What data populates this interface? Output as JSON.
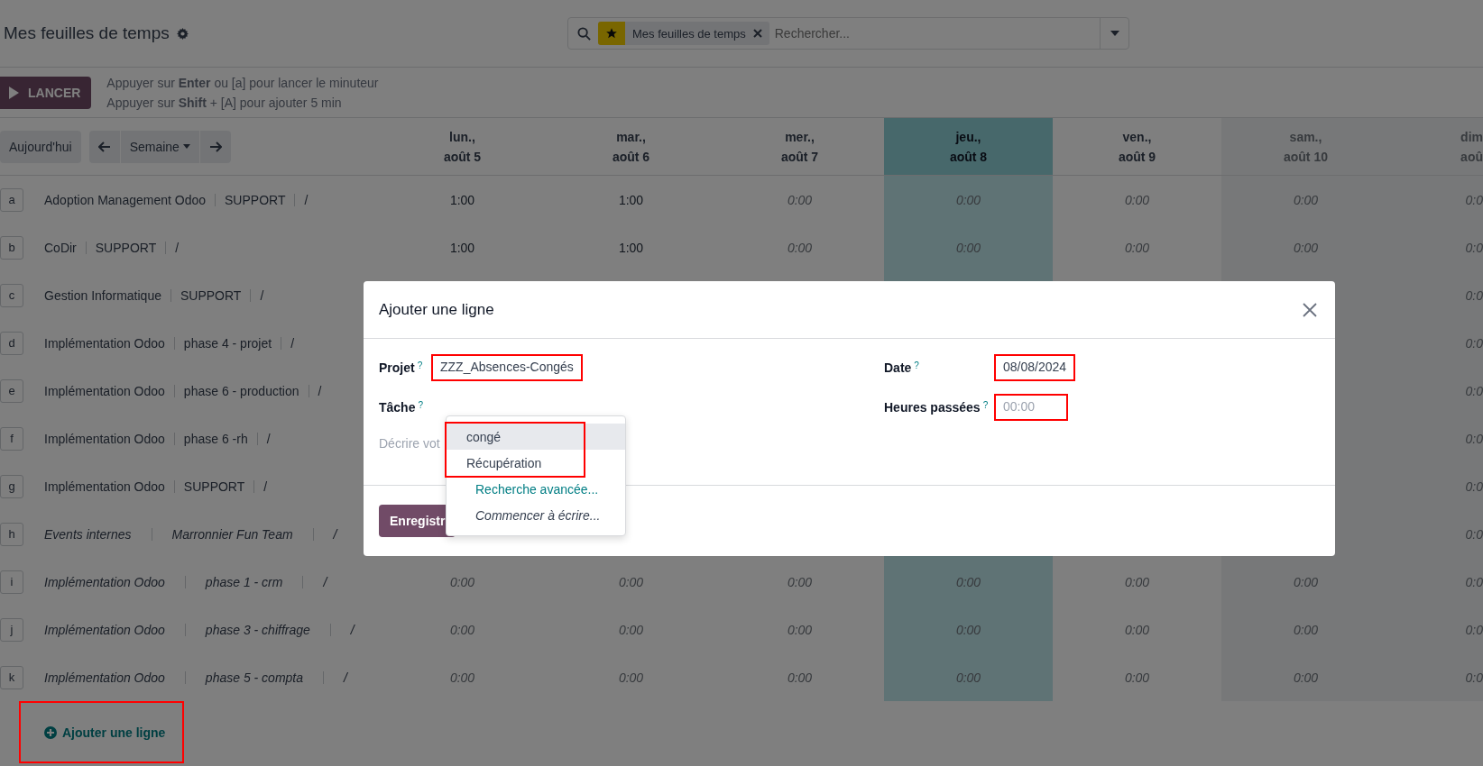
{
  "page": {
    "title": "Mes feuilles de temps"
  },
  "search": {
    "facets": [
      {
        "label": "Mes feuilles de temps"
      }
    ],
    "placeholder": "Rechercher..."
  },
  "timer": {
    "button": "LANCER",
    "hints": [
      "Appuyer sur **Enter** ou [a] pour lancer le minuteur",
      "Appuyer sur **Shift** + [A] pour ajouter 5 min"
    ]
  },
  "toolbar": {
    "today": "Aujourd'hui",
    "period": "Semaine"
  },
  "columns": [
    {
      "day": "lun.,",
      "date": "août 5",
      "kind": "weekday"
    },
    {
      "day": "mar.,",
      "date": "août 6",
      "kind": "weekday"
    },
    {
      "day": "mer.,",
      "date": "août 7",
      "kind": "weekday"
    },
    {
      "day": "jeu.,",
      "date": "août 8",
      "kind": "today"
    },
    {
      "day": "ven.,",
      "date": "août 9",
      "kind": "weekday"
    },
    {
      "day": "sam.,",
      "date": "août 10",
      "kind": "weekend"
    },
    {
      "day": "dim",
      "date": "aoû",
      "kind": "weekend"
    }
  ],
  "rows": [
    {
      "key": "a",
      "project": "Adoption Management Odoo",
      "task": "SUPPORT",
      "extra": "/",
      "italic": false,
      "cells": [
        {
          "value": "1:00",
          "empty": false
        },
        {
          "value": "1:00",
          "empty": false
        },
        {
          "value": "0:00",
          "empty": true
        },
        {
          "value": "0:00",
          "empty": true
        },
        {
          "value": "0:00",
          "empty": true
        },
        {
          "value": "0:00",
          "empty": true
        },
        {
          "value": "0:0",
          "empty": true
        }
      ]
    },
    {
      "key": "b",
      "project": "CoDir",
      "task": "SUPPORT",
      "extra": "/",
      "italic": false,
      "cells": [
        {
          "value": "1:00",
          "empty": false
        },
        {
          "value": "1:00",
          "empty": false
        },
        {
          "value": "0:00",
          "empty": true
        },
        {
          "value": "0:00",
          "empty": true
        },
        {
          "value": "0:00",
          "empty": true
        },
        {
          "value": "0:00",
          "empty": true
        },
        {
          "value": "0:0",
          "empty": true
        }
      ]
    },
    {
      "key": "c",
      "project": "Gestion Informatique",
      "task": "SUPPORT",
      "extra": "/",
      "italic": false,
      "cells": [
        null,
        null,
        null,
        null,
        null,
        null,
        {
          "value": "0:0",
          "empty": true
        }
      ]
    },
    {
      "key": "d",
      "project": "Implémentation Odoo",
      "task": "phase 4 - projet",
      "extra": "/",
      "italic": false,
      "cells": [
        null,
        null,
        null,
        null,
        null,
        null,
        {
          "value": "0:0",
          "empty": true
        }
      ]
    },
    {
      "key": "e",
      "project": "Implémentation Odoo",
      "task": "phase 6 - production",
      "extra": "/",
      "italic": false,
      "cells": [
        null,
        null,
        null,
        null,
        null,
        null,
        {
          "value": "0:0",
          "empty": true
        }
      ]
    },
    {
      "key": "f",
      "project": "Implémentation Odoo",
      "task": "phase 6 -rh",
      "extra": "/",
      "italic": false,
      "cells": [
        null,
        null,
        null,
        null,
        null,
        null,
        {
          "value": "0:0",
          "empty": true
        }
      ]
    },
    {
      "key": "g",
      "project": "Implémentation Odoo",
      "task": "SUPPORT",
      "extra": "/",
      "italic": false,
      "cells": [
        null,
        null,
        null,
        null,
        null,
        null,
        {
          "value": "0:0",
          "empty": true
        }
      ]
    },
    {
      "key": "h",
      "project": "Events internes",
      "task": "Marronnier Fun Team",
      "extra": "/",
      "italic": true,
      "cells": [
        null,
        null,
        null,
        null,
        null,
        null,
        {
          "value": "0:0",
          "empty": true
        }
      ]
    },
    {
      "key": "i",
      "project": "Implémentation Odoo",
      "task": "phase 1 - crm",
      "extra": "/",
      "italic": true,
      "cells": [
        {
          "value": "0:00",
          "empty": true
        },
        {
          "value": "0:00",
          "empty": true
        },
        {
          "value": "0:00",
          "empty": true
        },
        {
          "value": "0:00",
          "empty": true
        },
        {
          "value": "0:00",
          "empty": true
        },
        {
          "value": "0:00",
          "empty": true
        },
        {
          "value": "0:0",
          "empty": true
        }
      ]
    },
    {
      "key": "j",
      "project": "Implémentation Odoo",
      "task": "phase 3 - chiffrage",
      "extra": "/",
      "italic": true,
      "cells": [
        {
          "value": "0:00",
          "empty": true
        },
        {
          "value": "0:00",
          "empty": true
        },
        {
          "value": "0:00",
          "empty": true
        },
        {
          "value": "0:00",
          "empty": true
        },
        {
          "value": "0:00",
          "empty": true
        },
        {
          "value": "0:00",
          "empty": true
        },
        {
          "value": "0:0",
          "empty": true
        }
      ]
    },
    {
      "key": "k",
      "project": "Implémentation Odoo",
      "task": "phase 5 - compta",
      "extra": "/",
      "italic": true,
      "cells": [
        {
          "value": "0:00",
          "empty": true
        },
        {
          "value": "0:00",
          "empty": true
        },
        {
          "value": "0:00",
          "empty": true
        },
        {
          "value": "0:00",
          "empty": true
        },
        {
          "value": "0:00",
          "empty": true
        },
        {
          "value": "0:00",
          "empty": true
        },
        {
          "value": "0:0",
          "empty": true
        }
      ]
    }
  ],
  "add_line": {
    "label": "Ajouter une ligne",
    "highlighted": true
  },
  "dialog": {
    "title": "Ajouter une ligne",
    "left_fields": [
      {
        "label": "Projet",
        "help": "?",
        "value": "ZZZ_Absences-Congés",
        "highlighted": true
      },
      {
        "label": "Tâche",
        "help": "?",
        "highlighted": false
      }
    ],
    "right_fields": [
      {
        "label": "Date",
        "help": "?",
        "value": "08/08/2024",
        "highlighted": true
      },
      {
        "label": "Heures passées",
        "help": "?",
        "placeholder": "00:00",
        "highlighted": true
      }
    ],
    "description": {
      "placeholder": "Décrire vot"
    },
    "save": "Enregistr",
    "dropdown": {
      "highlighted": true,
      "options": [
        {
          "label": "congé",
          "selected": true
        },
        {
          "label": "Récupération",
          "selected": false
        }
      ],
      "actions": [
        {
          "label": "Recherche avancée...",
          "kind": "link"
        },
        {
          "label": "Commencer à écrire...",
          "kind": "hint"
        }
      ]
    }
  }
}
